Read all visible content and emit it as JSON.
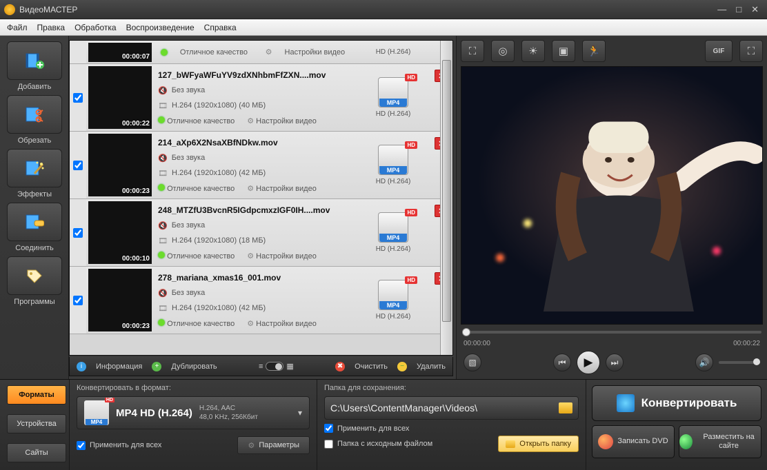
{
  "title": "ВидеоМАСТЕР",
  "menu": [
    "Файл",
    "Правка",
    "Обработка",
    "Воспроизведение",
    "Справка"
  ],
  "sidebar": [
    {
      "label": "Добавить",
      "icon": "add"
    },
    {
      "label": "Обрезать",
      "icon": "cut"
    },
    {
      "label": "Эффекты",
      "icon": "fx"
    },
    {
      "label": "Соединить",
      "icon": "join"
    },
    {
      "label": "Программы",
      "icon": "apps"
    }
  ],
  "quality_label": "Отличное качество",
  "settings_label": "Настройки видео",
  "codec_label": "HD (H.264)",
  "no_audio": "Без звука",
  "hd_badge": "HD",
  "mp4_badge": "MP4",
  "firstrow": {
    "duration": "00:00:07"
  },
  "items": [
    {
      "filename": "127_bWFyaWFuYV9zdXNhbmFfZXN....mov",
      "duration": "00:00:22",
      "info": "H.264 (1920x1080) (40 МБ)"
    },
    {
      "filename": "214_aXp6X2NsaXBfNDkw.mov",
      "duration": "00:00:23",
      "info": "H.264 (1920x1080) (42 МБ)"
    },
    {
      "filename": "248_MTZfU3BvcnR5IGdpcmxzIGF0IH....mov",
      "duration": "00:00:10",
      "info": "H.264 (1920x1080) (18 МБ)"
    },
    {
      "filename": "278_mariana_xmas16_001.mov",
      "duration": "00:00:23",
      "info": "H.264 (1920x1080) (42 МБ)"
    }
  ],
  "listbar": {
    "info": "Информация",
    "dup": "Дублировать",
    "clear": "Очистить",
    "del": "Удалить"
  },
  "preview_tools": [
    "crop",
    "rotate",
    "brightness",
    "enhance",
    "speed"
  ],
  "preview_extra": [
    "GIF",
    "expand"
  ],
  "player": {
    "cur": "00:00:00",
    "total": "00:00:22"
  },
  "tabs": {
    "formats": "Форматы",
    "devices": "Устройства",
    "sites": "Сайты"
  },
  "format_panel": {
    "title": "Конвертировать в формат:",
    "name": "MP4 HD (H.264)",
    "spec1": "H.264, AAC",
    "spec2": "48,0 KHz, 256Кбит",
    "apply_all": "Применить для всех",
    "params": "Параметры"
  },
  "save_panel": {
    "title": "Папка для сохранения:",
    "path": "C:\\Users\\ContentManager\\Videos\\",
    "apply_all": "Применить для всех",
    "same_folder": "Папка с исходным файлом",
    "open": "Открыть папку"
  },
  "actions": {
    "convert": "Конвертировать",
    "dvd": "Записать DVD",
    "upload": "Разместить на сайте"
  }
}
